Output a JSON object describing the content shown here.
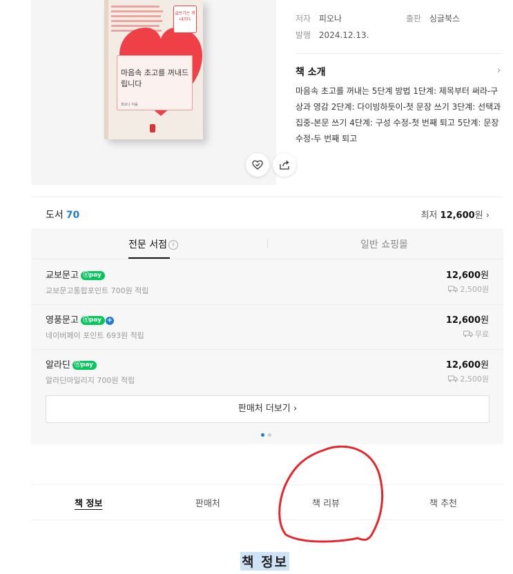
{
  "book": {
    "cover_title": "마음속 초고를 꺼내드립니다",
    "cover_author": "피오나 지음",
    "cover_tag": "글쓰기는 꺼내기다"
  },
  "meta": {
    "author_label": "저자",
    "author": "피오나",
    "publisher_label": "출판",
    "publisher": "싱글북스",
    "date_label": "발행",
    "date": "2024.12.13."
  },
  "intro": {
    "title": "책 소개",
    "text": "마음속 초고를 꺼내는 5단계 방법 1단계: 제목부터 써라-구상과 영감 2단계: 다이빙하듯이-첫 문장 쓰기 3단계: 선택과 집중-본문 쓰기 4단계: 구성 수정-첫 번째 퇴고 5단계: 문장 수정-두 번째 퇴고"
  },
  "books_row": {
    "label": "도서",
    "count": "70",
    "lowest_prefix": "최저",
    "lowest_price": "12,600",
    "lowest_suffix": "원 ›"
  },
  "seller_tabs": [
    {
      "label": "전문 서점"
    },
    {
      "label": "일반 쇼핑몰"
    }
  ],
  "sellers": [
    {
      "name": "교보문고",
      "badge": "pay",
      "point": "교보문고통합포인트 700원 적립",
      "price": "12,600",
      "unit": "원",
      "ship": "2,500원"
    },
    {
      "name": "영풍문고",
      "badge": "pay",
      "point": "네이버페이 포인트 693원 적립",
      "price": "12,600",
      "unit": "원",
      "ship": "무료"
    },
    {
      "name": "알라딘",
      "badge": "pay",
      "point": "알라딘마일리지 700원 적립",
      "price": "12,600",
      "unit": "원",
      "ship": "2,500원"
    }
  ],
  "more_sellers": "판매처 더보기 ›",
  "bottom_tabs": [
    {
      "label": "책 정보"
    },
    {
      "label": "판매처"
    },
    {
      "label": "책 리뷰"
    },
    {
      "label": "책 추천"
    }
  ],
  "section_heading": "책 정보",
  "colors": {
    "accent_blue": "#1f7bd8",
    "pay_green": "#03c75a",
    "annotation_red": "#e8232a"
  }
}
